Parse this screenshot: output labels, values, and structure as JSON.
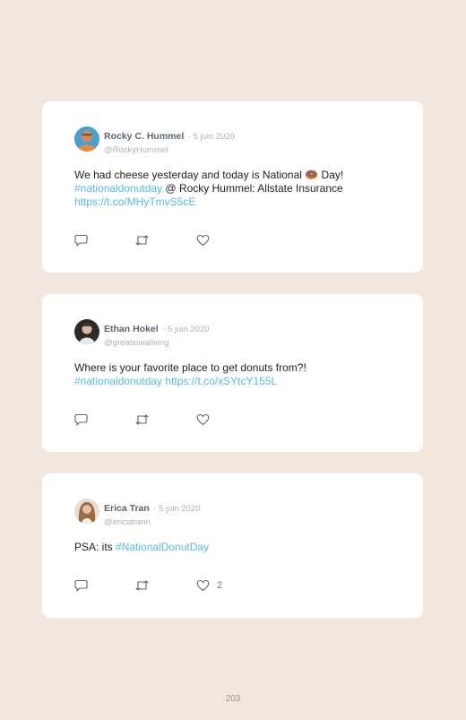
{
  "tweets": [
    {
      "name": "Rocky C. Hummel",
      "date": "· 5 juin 2020",
      "handle": "@RockyHummel",
      "line1": "We had cheese yesterday and today is National 🍩 Day!",
      "line2_link": "#nationaldonutday",
      "line2_rest": " @ Rocky Hummel: Allstate Insurance",
      "line3_link": "https://t.co/MHyTmvS5cE",
      "likes": ""
    },
    {
      "name": "Ethan Hokel",
      "date": "· 5 juin 2020",
      "handle": "@greatiowaliving",
      "line1": "Where is your favorite place to get donuts from?!",
      "line2_link": "#nationaldonutday https://t.co/xSYtcY155L",
      "likes": ""
    },
    {
      "name": "Erica Tran",
      "date": "· 5 juin 2020",
      "handle": "@ericatrann",
      "line1_text": "PSA: its ",
      "line1_link": "#NationalDonutDay",
      "likes": "2"
    }
  ],
  "icons": {
    "reply": "speech-bubble-icon",
    "retweet": "retweet-arrows-icon",
    "like": "heart-icon"
  },
  "colors": {
    "background": "#f3e6dc",
    "link": "#5bb8df",
    "icon": "#5b6670"
  },
  "page_number": "203"
}
